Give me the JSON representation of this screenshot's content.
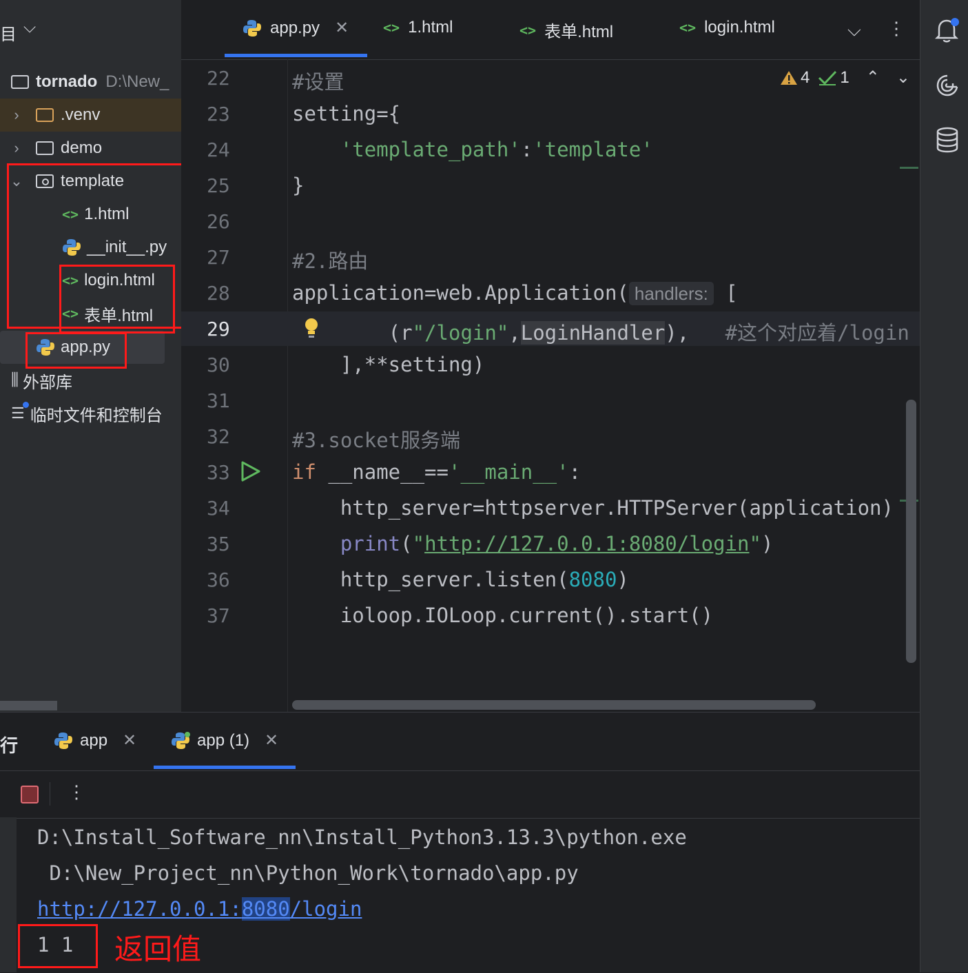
{
  "project": {
    "header_fragment": "目",
    "header_chevron": "chevron-down",
    "root": {
      "name": "tornado",
      "path": "D:\\New_"
    },
    "items": [
      {
        "label": ".venv",
        "type": "folder",
        "expanded": false
      },
      {
        "label": "demo",
        "type": "folder",
        "expanded": false
      },
      {
        "label": "template",
        "type": "package",
        "expanded": true
      },
      {
        "label": "1.html",
        "type": "html"
      },
      {
        "label": "__init__.py",
        "type": "python"
      },
      {
        "label": "login.html",
        "type": "html"
      },
      {
        "label": "表单.html",
        "type": "html"
      },
      {
        "label": "app.py",
        "type": "python"
      },
      {
        "label": "外部库",
        "type": "library"
      },
      {
        "label": "临时文件和控制台",
        "type": "scratch"
      }
    ]
  },
  "editor": {
    "tabs": [
      {
        "label": "app.py",
        "active": true,
        "closable": true
      },
      {
        "label": "1.html"
      },
      {
        "label": "表单.html"
      },
      {
        "label": "login.html"
      }
    ],
    "inspections": {
      "warnings": "4",
      "ok": "1"
    },
    "gutter": [
      "22",
      "23",
      "24",
      "25",
      "26",
      "27",
      "28",
      "29",
      "30",
      "31",
      "32",
      "33",
      "34",
      "35",
      "36",
      "37"
    ],
    "code": {
      "l22": "#设置",
      "l23": "setting={",
      "l24_indent": "    ",
      "l24_str1": "'template_path'",
      "l24_colon": ":",
      "l24_str2": "'template'",
      "l25": "}",
      "l27": "#2.路由",
      "l28_code": "application=web.Application(",
      "l28_hint": "handlers:",
      "l28_tail": " [",
      "l29_indent": "        (r",
      "l29_str": "\"/login\"",
      "l29_comma": ",",
      "l29_class": "LoginHandler",
      "l29_close": "),   ",
      "l29_cmt": "#这个对应着/login",
      "l30": "    ],**setting)",
      "l32": "#3.socket服务端",
      "l33_kw": "if",
      "l33_mid": " __name__==",
      "l33_str": "'__main__'",
      "l33_end": ":",
      "l34": "    http_server=httpserver.HTTPServer(application)",
      "l35_indent": "    ",
      "l35_builtin": "print",
      "l35_open": "(",
      "l35_q1": "\"",
      "l35_url": "http://127.0.0.1:8080/login",
      "l35_q2": "\"",
      "l35_close": ")",
      "l36_pre": "    http_server.listen(",
      "l36_num": "8080",
      "l36_post": ")",
      "l37": "    ioloop.IOLoop.current().start()"
    }
  },
  "run_panel": {
    "title_fragment": "行",
    "tabs": [
      {
        "label": "app",
        "closable": true
      },
      {
        "label": "app (1)",
        "closable": true,
        "active": true
      }
    ],
    "console": {
      "line1": "D:\\Install_Software_nn\\Install_Python3.13.3\\python.exe",
      "line2": " D:\\New_Project_nn\\Python_Work\\tornado\\app.py",
      "url_a": "http://127.0.0.1:",
      "url_b": "8080",
      "url_c": "/login",
      "output": "1 1"
    },
    "annotation": "返回值"
  },
  "colors": {
    "annotation_red": "#ff1a1a",
    "string_green": "#6aab73",
    "keyword_orange": "#cf8e6d",
    "number_teal": "#2aacb8",
    "link_blue": "#548af7"
  }
}
